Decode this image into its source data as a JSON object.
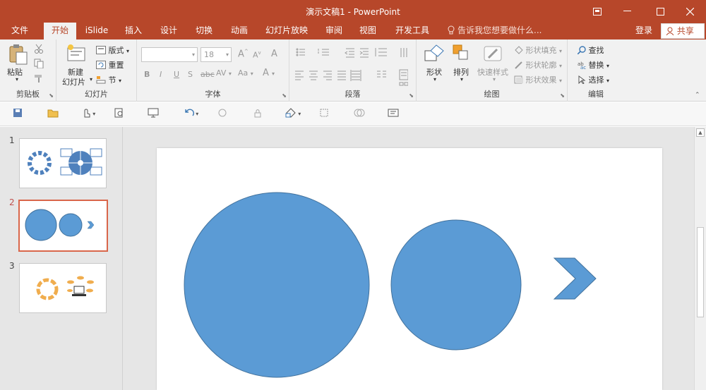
{
  "window": {
    "title": "演示文稿1 - PowerPoint",
    "controls": {
      "ribbon_display": "⧉",
      "minimize": "—",
      "maximize": "☐",
      "close": "✕"
    }
  },
  "tabs": [
    {
      "label": "文件"
    },
    {
      "label": "开始",
      "active": true
    },
    {
      "label": "iSlide"
    },
    {
      "label": "插入"
    },
    {
      "label": "设计"
    },
    {
      "label": "切换"
    },
    {
      "label": "动画"
    },
    {
      "label": "幻灯片放映"
    },
    {
      "label": "审阅"
    },
    {
      "label": "视图"
    },
    {
      "label": "开发工具"
    }
  ],
  "tell_me": {
    "placeholder": "告诉我您想要做什么..."
  },
  "account": {
    "login": "登录",
    "share": "共享"
  },
  "ribbon": {
    "clipboard": {
      "label": "剪贴板",
      "paste": "粘贴"
    },
    "slides": {
      "label": "幻灯片",
      "new_slide_1": "新建",
      "new_slide_2": "幻灯片",
      "layout": "版式",
      "reset": "重置",
      "section": "节"
    },
    "font": {
      "label": "字体",
      "font_name": "",
      "font_size": "18",
      "bold": "B",
      "italic": "I",
      "underline": "U",
      "shadow": "S",
      "strike": "abc",
      "spacing": "AV",
      "case": "Aa",
      "color": "A",
      "grow": "A",
      "shrink": "A",
      "clear": "A"
    },
    "paragraph": {
      "label": "段落"
    },
    "drawing": {
      "label": "绘图",
      "shapes": "形状",
      "arrange": "排列",
      "quick_styles": "快速样式",
      "fill": "形状填充",
      "outline": "形状轮廓",
      "effects": "形状效果"
    },
    "editing": {
      "label": "编辑",
      "find": "查找",
      "replace": "替换",
      "select": "选择"
    }
  },
  "thumbnails": [
    {
      "number": "1"
    },
    {
      "number": "2",
      "active": true
    },
    {
      "number": "3"
    }
  ],
  "colors": {
    "brand": "#b7472a",
    "shape_fill": "#5b9bd5",
    "shape_stroke": "#41719c",
    "thumb_accent": "#4f81bd",
    "orange_accent": "#f0ad4e",
    "active_thumb": "#d9664a"
  },
  "icons": {
    "save": "save-icon",
    "open": "folder-icon",
    "touch": "touch-mode-icon",
    "preview": "print-preview-icon",
    "present": "slideshow-icon",
    "undo": "undo-icon",
    "redo": "redo-icon",
    "lock": "lock-icon",
    "shape_qat": "shape-icon",
    "align": "align-icon",
    "merge": "merge-shapes-icon",
    "textbox": "textbox-icon"
  }
}
